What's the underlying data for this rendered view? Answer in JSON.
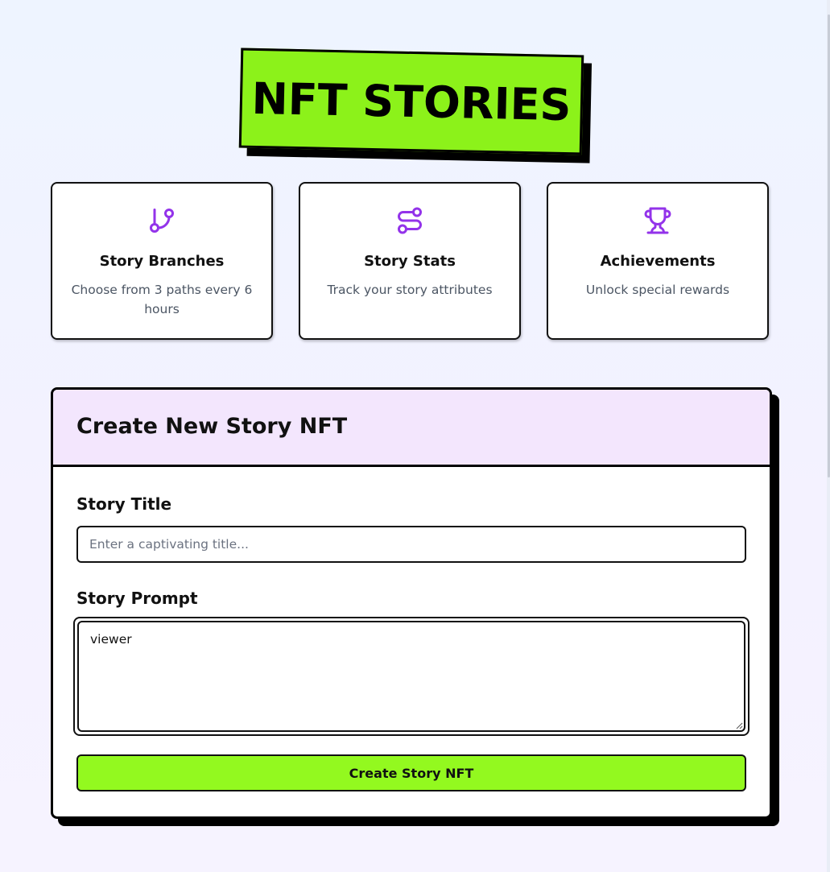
{
  "header": {
    "title": "NFT STORIES"
  },
  "features": [
    {
      "icon": "git-branch-icon",
      "title": "Story Branches",
      "description": "Choose from 3 paths every 6 hours"
    },
    {
      "icon": "route-icon",
      "title": "Story Stats",
      "description": "Track your story attributes"
    },
    {
      "icon": "trophy-icon",
      "title": "Achievements",
      "description": "Unlock special rewards"
    }
  ],
  "form": {
    "heading": "Create New Story NFT",
    "title_label": "Story Title",
    "title_placeholder": "Enter a captivating title...",
    "title_value": "",
    "prompt_label": "Story Prompt",
    "prompt_value": "viewer",
    "submit_label": "Create Story NFT"
  },
  "colors": {
    "accent_green": "#8cf21a",
    "button_green": "#93f91f",
    "icon_purple": "#9333ea",
    "header_lavender": "#f3e6fd"
  }
}
